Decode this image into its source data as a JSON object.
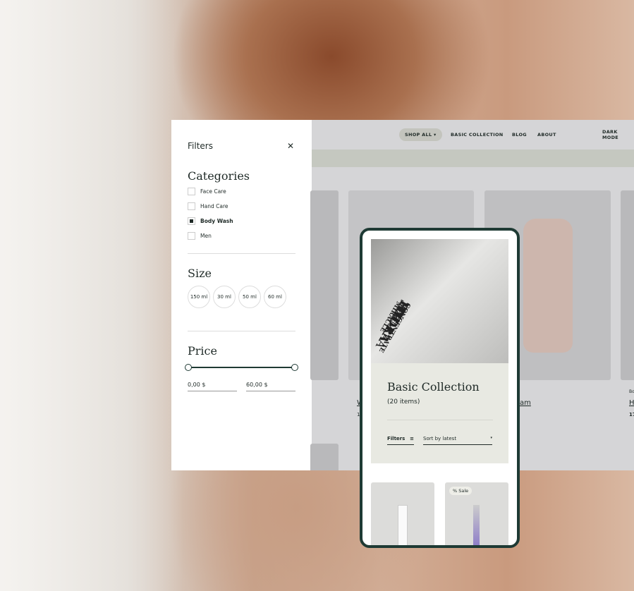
{
  "filters": {
    "title": "Filters",
    "close_icon": "close-icon",
    "categories_heading": "Categories",
    "categories": [
      {
        "label": "Face Care",
        "checked": false
      },
      {
        "label": "Hand Care",
        "checked": false
      },
      {
        "label": "Body Wash",
        "checked": true
      },
      {
        "label": "Men",
        "checked": false
      }
    ],
    "size_heading": "Size",
    "sizes": [
      "150 ml",
      "30 ml",
      "50 ml",
      "60 ml"
    ],
    "price_heading": "Price",
    "price_min": "0,00 $",
    "price_max": "60,00 $"
  },
  "nav": {
    "items": [
      "SHOP ALL",
      "BASIC COLLECTION",
      "BLOG",
      "ABOUT"
    ],
    "dark_mode": "DARK MODE"
  },
  "desktop_products": [
    {
      "title": "W",
      "price": "1"
    },
    {
      "title": "am"
    },
    {
      "category": "Bo",
      "title": "H",
      "price": "17"
    }
  ],
  "mobile": {
    "hero_text": [
      "MÁDARA",
      "organic skincare",
      "TIME MIRACLE",
      "HYDRA",
      "FIRM",
      "CONCENTRATE"
    ],
    "collection_title": "Basic Collection",
    "item_count": "(20 items)",
    "filters_label": "Filters",
    "sort_label": "Sort by latest",
    "sale_badge": "% Sale"
  },
  "colors": {
    "accent": "#1e3a34",
    "panel": "#e8e9e2"
  }
}
